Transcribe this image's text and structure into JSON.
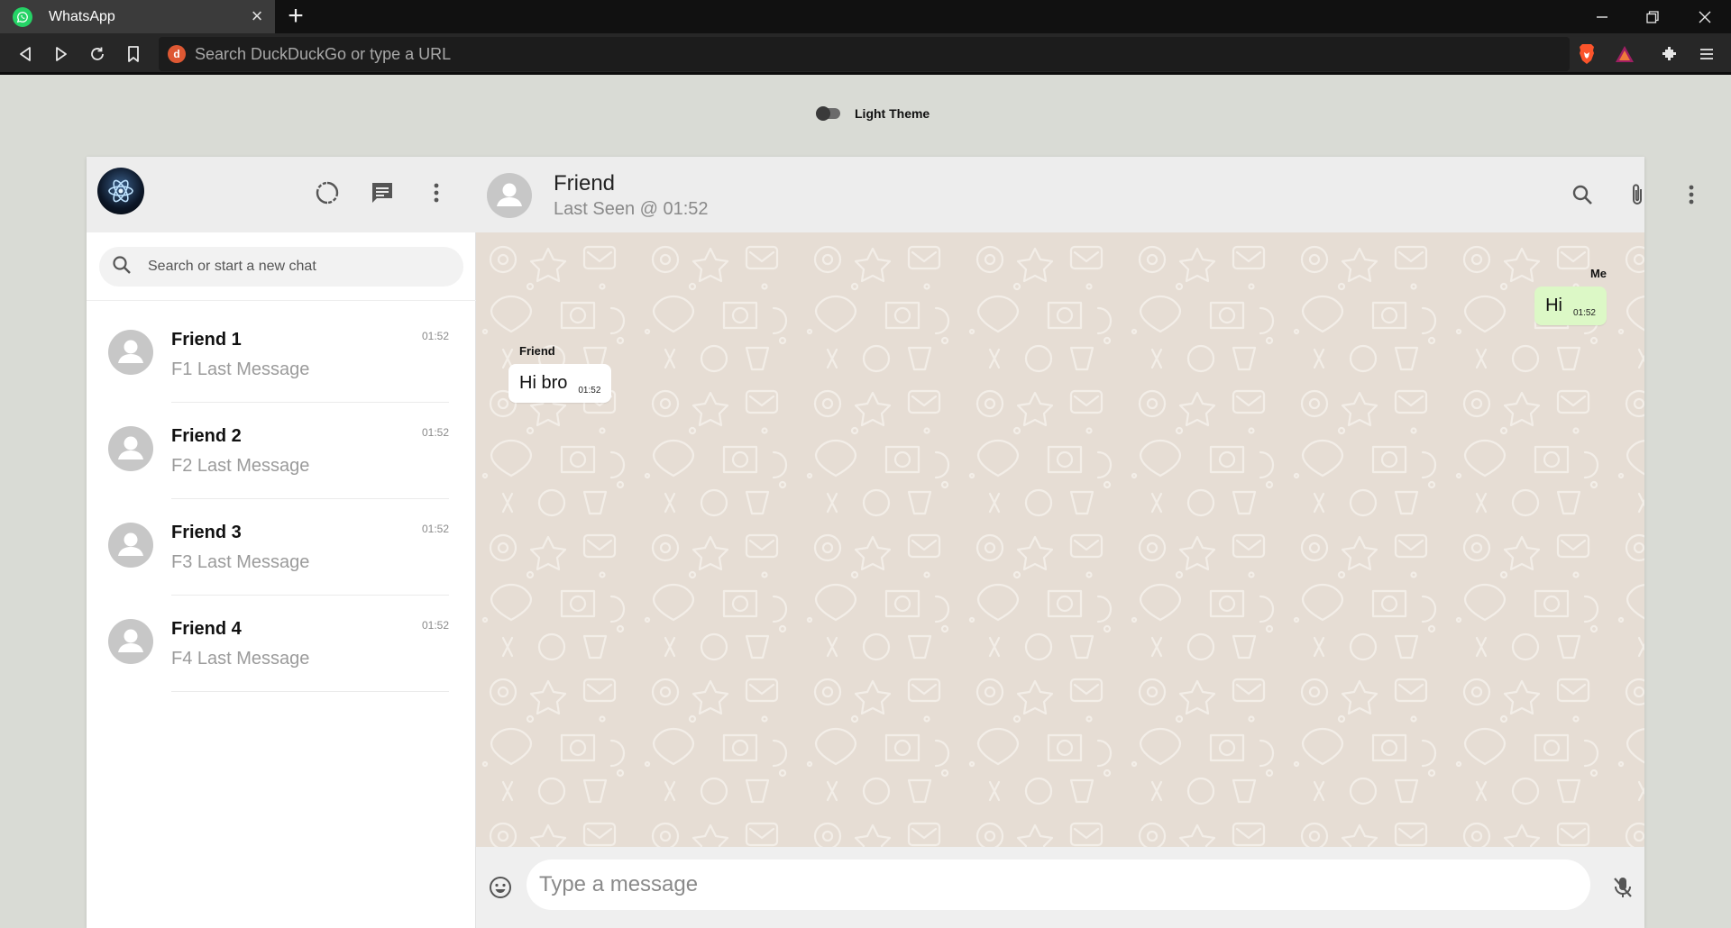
{
  "browser": {
    "tab_title": "WhatsApp",
    "tab_icon": "whatsapp-icon",
    "url_placeholder": "Search DuckDuckGo or type a URL",
    "search_engine_icon": "duckduckgo-icon"
  },
  "theme_toggle": {
    "label": "Light Theme",
    "enabled": false
  },
  "sidebar": {
    "search_placeholder": "Search or start a new chat",
    "header_icons": [
      "status-icon",
      "new-chat-icon",
      "menu-icon"
    ],
    "chats": [
      {
        "name": "Friend 1",
        "last_message": "F1 Last Message",
        "time": "01:52"
      },
      {
        "name": "Friend 2",
        "last_message": "F2 Last Message",
        "time": "01:52"
      },
      {
        "name": "Friend 3",
        "last_message": "F3 Last Message",
        "time": "01:52"
      },
      {
        "name": "Friend 4",
        "last_message": "F4 Last Message",
        "time": "01:52"
      }
    ]
  },
  "conversation": {
    "name": "Friend",
    "status": "Last Seen @ 01:52",
    "header_icons": [
      "search-icon",
      "attach-icon",
      "menu-icon"
    ],
    "messages": [
      {
        "direction": "out",
        "sender": "Me",
        "text": "Hi",
        "time": "01:52"
      },
      {
        "direction": "in",
        "sender": "Friend",
        "text": "Hi bro",
        "time": "01:52"
      }
    ],
    "input_placeholder": "Type a message"
  },
  "colors": {
    "app_background": "#d9dbd5",
    "header_background": "#ededed",
    "chat_wallpaper": "#e6ddd4",
    "outgoing_bubble": "#dcf8c6",
    "incoming_bubble": "#ffffff",
    "brand": "#25d366"
  }
}
